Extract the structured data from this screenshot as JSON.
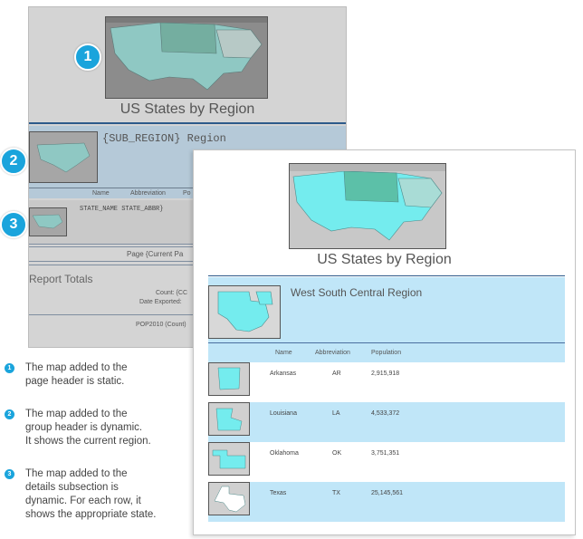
{
  "design_view": {
    "title": "US States by Region",
    "group_field": "{SUB_REGION} Region",
    "col_name": "Name",
    "col_abbr": "Abbreviation",
    "col_pop": "Po",
    "detail_fields": "STATE_NAME  STATE_ABBR}",
    "page_footer": "Page {Current Pa",
    "totals_title": "Report Totals",
    "count_label": "Count: {CC",
    "date_exported": "Date Exported:",
    "pop_total": "POP2010 (Count)"
  },
  "report": {
    "title": "US States by Region",
    "region": "West South Central Region",
    "columns": {
      "name": "Name",
      "abbr": "Abbreviation",
      "pop": "Population"
    },
    "rows": [
      {
        "name": "Arkansas",
        "abbr": "AR",
        "pop": "2,915,918"
      },
      {
        "name": "Louisiana",
        "abbr": "LA",
        "pop": "4,533,372"
      },
      {
        "name": "Oklahoma",
        "abbr": "OK",
        "pop": "3,751,351"
      },
      {
        "name": "Texas",
        "abbr": "TX",
        "pop": "25,145,561"
      }
    ]
  },
  "callouts": [
    "1",
    "2",
    "3"
  ],
  "legend": [
    {
      "num": "1",
      "lines": [
        "The map added to the",
        "page header is static."
      ]
    },
    {
      "num": "2",
      "lines": [
        "The map added to the",
        "group header is dynamic.",
        "It shows the current region."
      ]
    },
    {
      "num": "3",
      "lines": [
        "The map added to the",
        "details subsection is",
        "dynamic. For each row, it",
        "shows the appropriate state."
      ]
    }
  ],
  "colors": {
    "accent": "#1aa4dc",
    "band": "#c0e6f8",
    "header_line": "#2d5a8a"
  }
}
